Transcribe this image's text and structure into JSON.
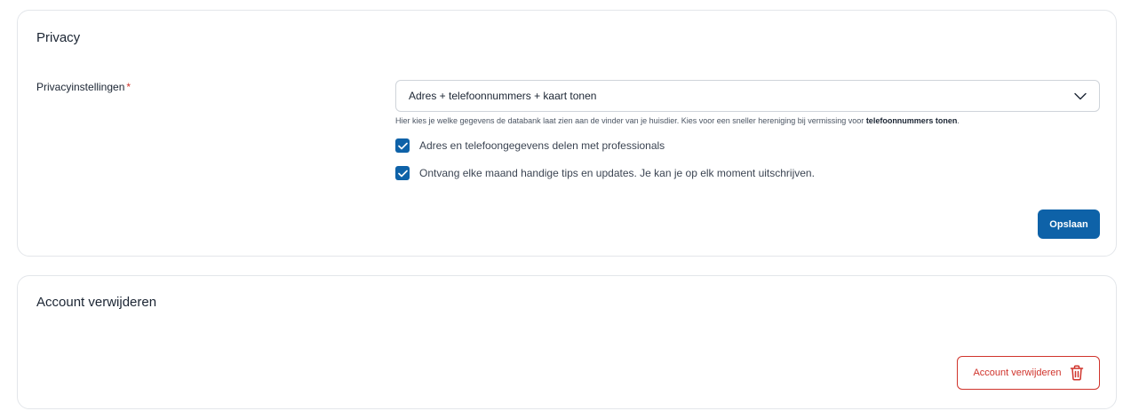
{
  "privacy": {
    "title": "Privacy",
    "field_label": "Privacyinstellingen",
    "required_marker": "*",
    "select_value": "Adres + telefoonnummers + kaart tonen",
    "help_text": "Hier kies je welke gegevens de databank laat zien aan de vinder van je huisdier. Kies voor een sneller hereniging bij vermissing voor ",
    "help_text_bold": "telefoonnummers tonen",
    "help_text_end": ".",
    "checkboxes": [
      {
        "label": "Adres en telefoongegevens delen met professionals",
        "checked": true
      },
      {
        "label": "Ontvang elke maand handige tips en updates. Je kan je op elk moment uitschrijven.",
        "checked": true
      }
    ],
    "save_label": "Opslaan"
  },
  "delete_account": {
    "title": "Account verwijderen",
    "button_label": "Account verwijderen"
  },
  "colors": {
    "primary": "#0e62a8",
    "danger": "#d0342c",
    "border": "#e3e6ea"
  },
  "icons": {
    "select": "chevron-down-icon",
    "checkbox": "check-icon",
    "delete": "trash-icon"
  }
}
